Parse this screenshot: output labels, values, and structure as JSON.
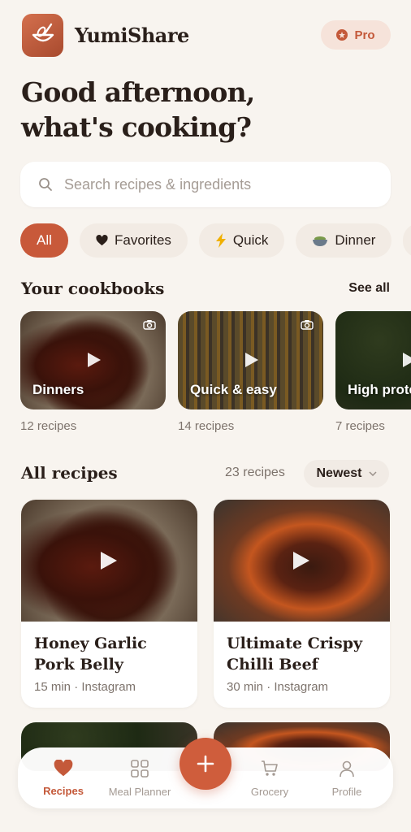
{
  "app": {
    "name": "YumiShare",
    "pro_label": "Pro"
  },
  "greeting": {
    "line1": "Good afternoon,",
    "line2": "what's cooking?"
  },
  "search": {
    "placeholder": "Search recipes & ingredients"
  },
  "filters": [
    {
      "label": "All",
      "icon": "",
      "active": true
    },
    {
      "label": "Favorites",
      "icon": "heart-icon"
    },
    {
      "label": "Quick",
      "icon": "lightning-icon"
    },
    {
      "label": "Dinner",
      "icon": "bowl-icon"
    }
  ],
  "cookbooks": {
    "title": "Your cookbooks",
    "see_all": "See all",
    "items": [
      {
        "name": "Dinners",
        "count": "12 recipes"
      },
      {
        "name": "Quick & easy",
        "count": "14 recipes"
      },
      {
        "name": "High protein",
        "count": "7 recipes"
      }
    ]
  },
  "recipes": {
    "title": "All recipes",
    "count": "23 recipes",
    "sort": "Newest",
    "items": [
      {
        "title": "Honey Garlic Pork Belly",
        "meta": "15 min · Instagram"
      },
      {
        "title": "Ultimate Crispy Chilli Beef",
        "meta": "30 min · Instagram"
      }
    ]
  },
  "nav": {
    "items": [
      {
        "label": "Recipes",
        "active": true
      },
      {
        "label": "Meal Planner"
      },
      {
        "label": "Grocery"
      },
      {
        "label": "Profile"
      }
    ],
    "add_icon": "plus-icon"
  },
  "colors": {
    "accent": "#c8593a",
    "background": "#f8f4ef",
    "pro_bg": "#f6e3da"
  }
}
